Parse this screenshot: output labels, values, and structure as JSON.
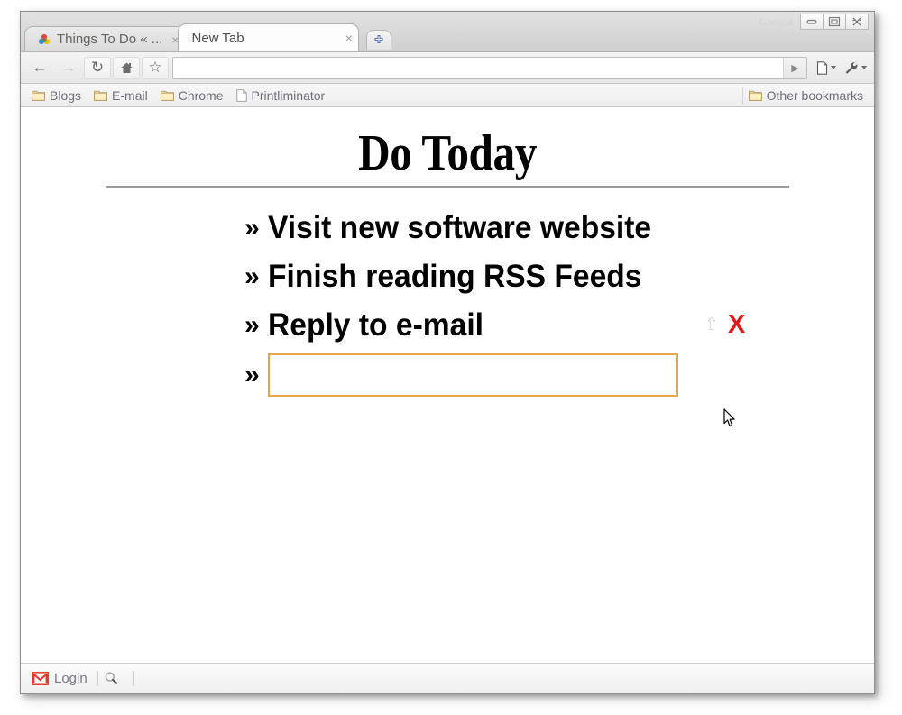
{
  "window": {
    "watermark": "Google",
    "controls": [
      {
        "name": "minimize",
        "glyph": "–"
      },
      {
        "name": "maximize",
        "glyph": "□"
      },
      {
        "name": "close",
        "glyph": "✖"
      }
    ]
  },
  "tabs": [
    {
      "label": "Things To Do « ...",
      "close": "×",
      "favicon": "colorful-star-favicon",
      "active": false
    },
    {
      "label": "New Tab",
      "close": "×",
      "favicon": "none",
      "active": true
    }
  ],
  "new_tab_button": {
    "name": "new-tab-button",
    "glyph": "+"
  },
  "toolbar": {
    "back": "←",
    "forward": "→",
    "reload": "↻",
    "home": "⌂",
    "bookmark_star": "☆",
    "go": "▶",
    "page_menu": "page-menu",
    "wrench_menu": "wrench-menu"
  },
  "omnibox": {
    "value": "",
    "placeholder": ""
  },
  "bookmarks": {
    "items": [
      {
        "label": "Blogs",
        "icon": "folder-icon"
      },
      {
        "label": "E-mail",
        "icon": "folder-icon"
      },
      {
        "label": "Chrome",
        "icon": "folder-icon"
      },
      {
        "label": "Printliminator",
        "icon": "page-icon"
      }
    ],
    "other": {
      "label": "Other bookmarks",
      "icon": "folder-icon"
    }
  },
  "page": {
    "title": "Do Today",
    "marker": "»",
    "items": [
      {
        "text": "Visit new software website",
        "hovered": false
      },
      {
        "text": "Finish reading RSS Feeds",
        "hovered": false
      },
      {
        "text": "Reply to e-mail",
        "hovered": true
      }
    ],
    "controls": {
      "move_up": "⇧",
      "delete": "X"
    },
    "new_item": {
      "marker": "»",
      "value": "",
      "placeholder": ""
    },
    "colors": {
      "input_border": "#e3a44a",
      "delete": "#e01b1b",
      "rule": "#9a9a9a"
    }
  },
  "status_bar": {
    "items": [
      {
        "label": "Login",
        "icon": "gmail-icon"
      },
      {
        "label": "",
        "icon": "search-icon"
      }
    ]
  }
}
